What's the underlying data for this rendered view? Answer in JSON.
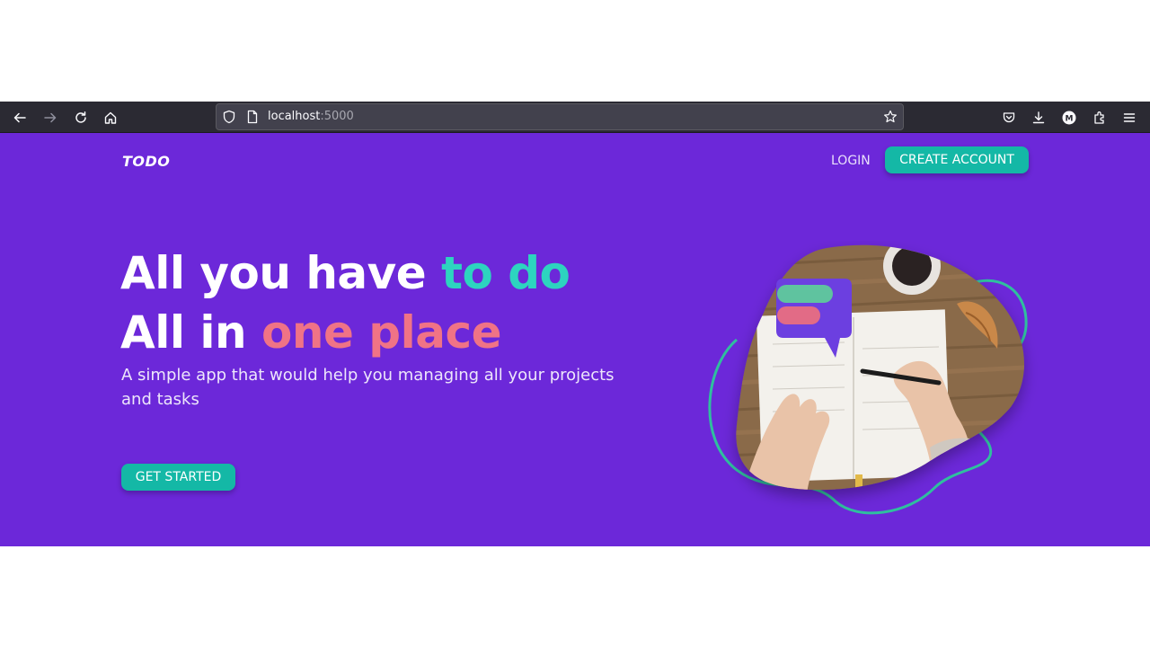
{
  "browser": {
    "url_host": "localhost",
    "url_port": ":5000",
    "icons": [
      "back-icon",
      "forward-icon",
      "reload-icon",
      "home-icon",
      "shield-icon",
      "page-icon",
      "star-icon",
      "pocket-icon",
      "download-icon",
      "account-icon",
      "extensions-icon",
      "menu-icon"
    ],
    "account_initial": "M"
  },
  "nav": {
    "logo": "TODO",
    "login": "LOGIN",
    "create_account": "CREATE ACCOUNT"
  },
  "hero": {
    "line1_plain": "All you have ",
    "line1_accent": "to do",
    "line2_plain": "All in ",
    "line2_accent": "one place",
    "subtitle": "A simple app that would help you managing all your projects and tasks",
    "cta": "GET STARTED"
  },
  "colors": {
    "page_bg": "#6c28d9",
    "teal": "#14b8a6",
    "teal_text": "#2dd4bf",
    "pink_text": "#f07386",
    "toolbar_bg": "#2b2a33"
  }
}
